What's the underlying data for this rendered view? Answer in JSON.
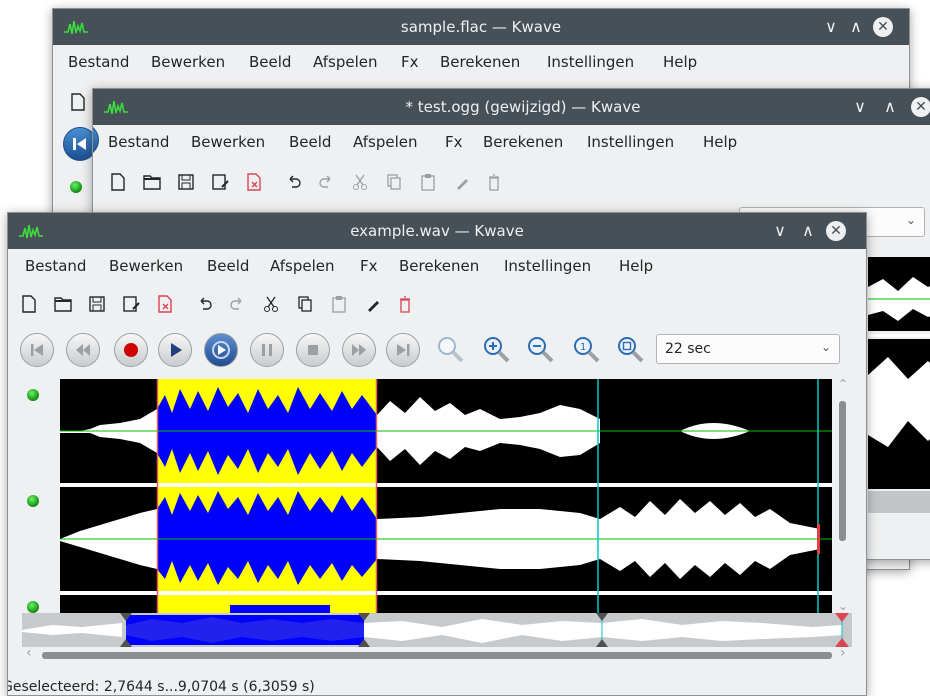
{
  "windows": {
    "back": {
      "title": "sample.flac — Kwave"
    },
    "mid": {
      "title": "* test.ogg (gewijzigd) — Kwave"
    },
    "front": {
      "title": "example.wav — Kwave"
    }
  },
  "titlebar_buttons": {
    "minimize": "∨",
    "maximize": "∧",
    "close": "✕"
  },
  "menu": [
    "Bestand",
    "Bewerken",
    "Beeld",
    "Afspelen",
    "Fx",
    "Berekenen",
    "Instellingen",
    "Help"
  ],
  "toolbar_icons": [
    "new-file-icon",
    "open-folder-icon",
    "save-icon",
    "save-as-icon",
    "close-file-icon",
    "undo-icon",
    "redo-icon",
    "cut-icon",
    "copy-icon",
    "paste-icon",
    "erase-icon",
    "delete-icon"
  ],
  "transport_icons": [
    "skip-to-start-icon",
    "rewind-icon",
    "record-icon",
    "play-icon",
    "loop-play-icon",
    "pause-icon",
    "stop-icon",
    "forward-icon",
    "skip-to-end-icon"
  ],
  "zoom_icons": [
    "zoom-to-selection-icon",
    "zoom-in-icon",
    "zoom-out-icon",
    "zoom-original-icon",
    "zoom-fit-icon"
  ],
  "zoom": {
    "value": "22 sec"
  },
  "selection": {
    "start_s": 2.7644,
    "end_s": 9.0704
  },
  "status": {
    "text": "Geselecteerd: 2,7644 s...9,0704 s (6,3059 s)"
  },
  "colors": {
    "titlebar": "#475057",
    "window_bg": "#eff0f1",
    "selection": "#ffff00",
    "wave_selected": "#0000ff",
    "wave": "#ffffff",
    "signal_bg": "#000000",
    "zero_line": "#00c000",
    "marker": "#00c8c8",
    "record": "#d00000"
  }
}
